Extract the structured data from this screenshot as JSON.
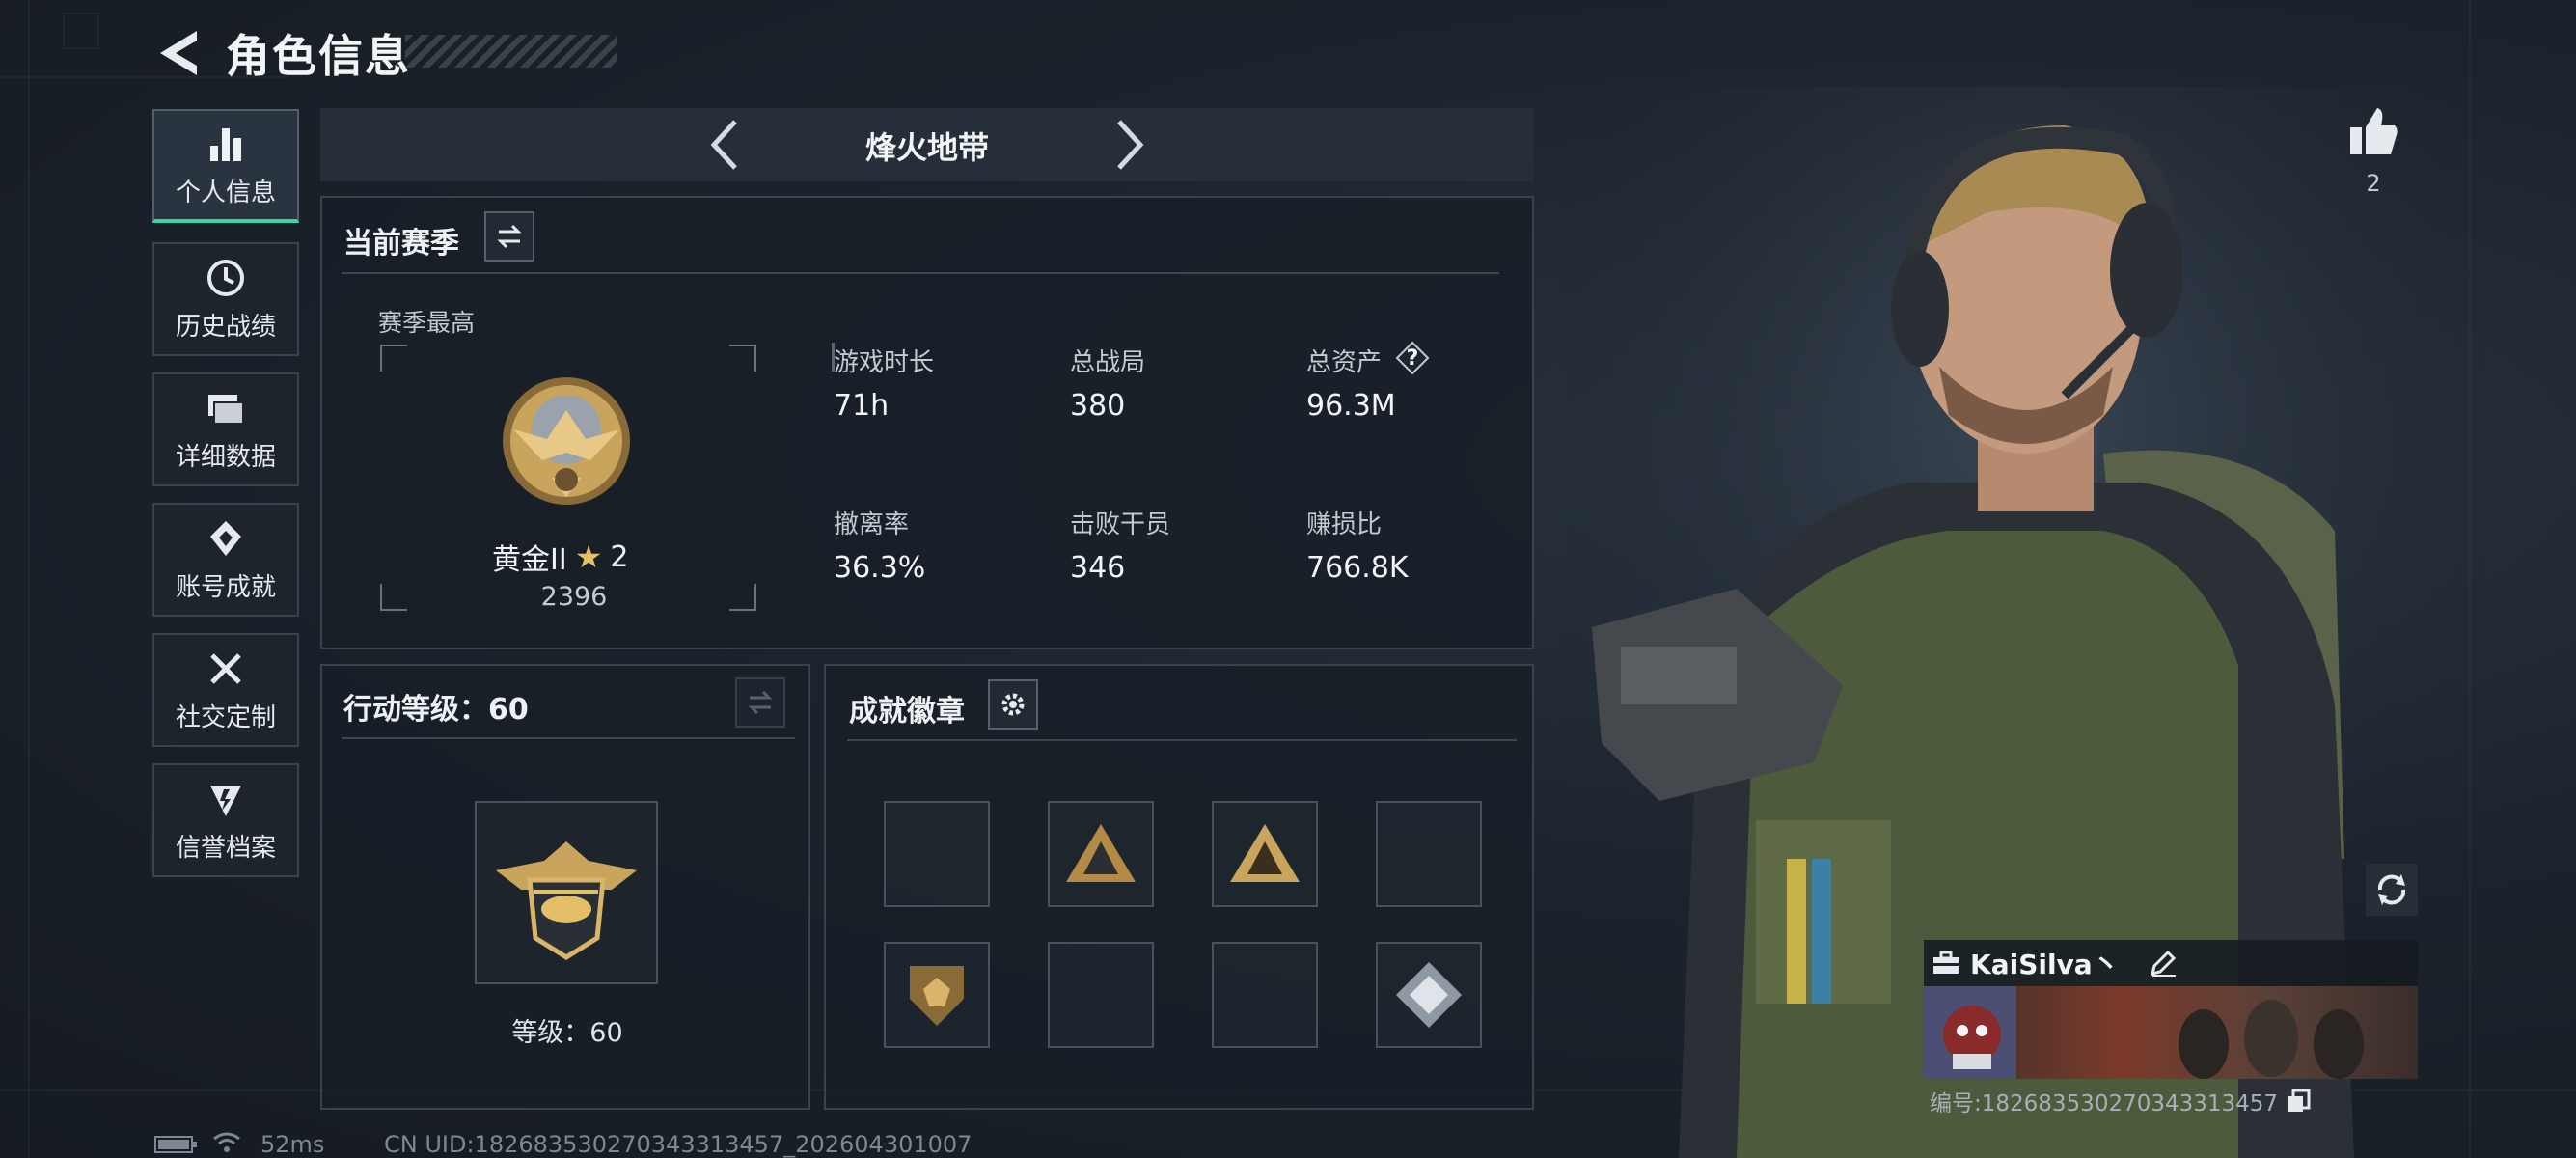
{
  "header": {
    "title": "角色信息"
  },
  "sidebar": {
    "items": [
      {
        "label": "个人信息",
        "icon": "bar-chart-icon",
        "active": true
      },
      {
        "label": "历史战绩",
        "icon": "clock-history-icon",
        "active": false
      },
      {
        "label": "详细数据",
        "icon": "folder-icon",
        "active": false
      },
      {
        "label": "账号成就",
        "icon": "achievement-icon",
        "active": false
      },
      {
        "label": "社交定制",
        "icon": "tools-icon",
        "active": false
      },
      {
        "label": "信誉档案",
        "icon": "shield-lightning-icon",
        "active": false
      }
    ]
  },
  "mode": {
    "name": "烽火地带"
  },
  "season": {
    "title": "当前赛季",
    "best_label": "赛季最高",
    "rank_name": "黄金II",
    "rank_stars": "2",
    "rank_score": "2396",
    "stats": [
      {
        "label": "游戏时长",
        "value": "71h"
      },
      {
        "label": "总战局",
        "value": "380"
      },
      {
        "label": "总资产",
        "value": "96.3M"
      },
      {
        "label": "撤离率",
        "value": "36.3%"
      },
      {
        "label": "击败干员",
        "value": "346"
      },
      {
        "label": "赚损比",
        "value": "766.8K"
      }
    ],
    "help_glyph": "?"
  },
  "action_level": {
    "title": "行动等级：60",
    "level_text": "等级：60"
  },
  "badges": {
    "title": "成就徽章",
    "slots": [
      "empty",
      "gold-triangle-badge",
      "gold-triangle-badge",
      "empty",
      "shield-badge",
      "empty",
      "empty",
      "diamond-badge"
    ]
  },
  "likes": {
    "count": "2"
  },
  "player": {
    "name": "KaiSilva丶",
    "id_text": "编号:18268353027034331345​7"
  },
  "status_bar": {
    "ping": "52ms",
    "uid_text": "CN UID:18268353027034331345​7_202604301007"
  },
  "colors": {
    "accent": "#3ad3a6",
    "gold": "#c9a45c",
    "panel": "#181f27"
  }
}
